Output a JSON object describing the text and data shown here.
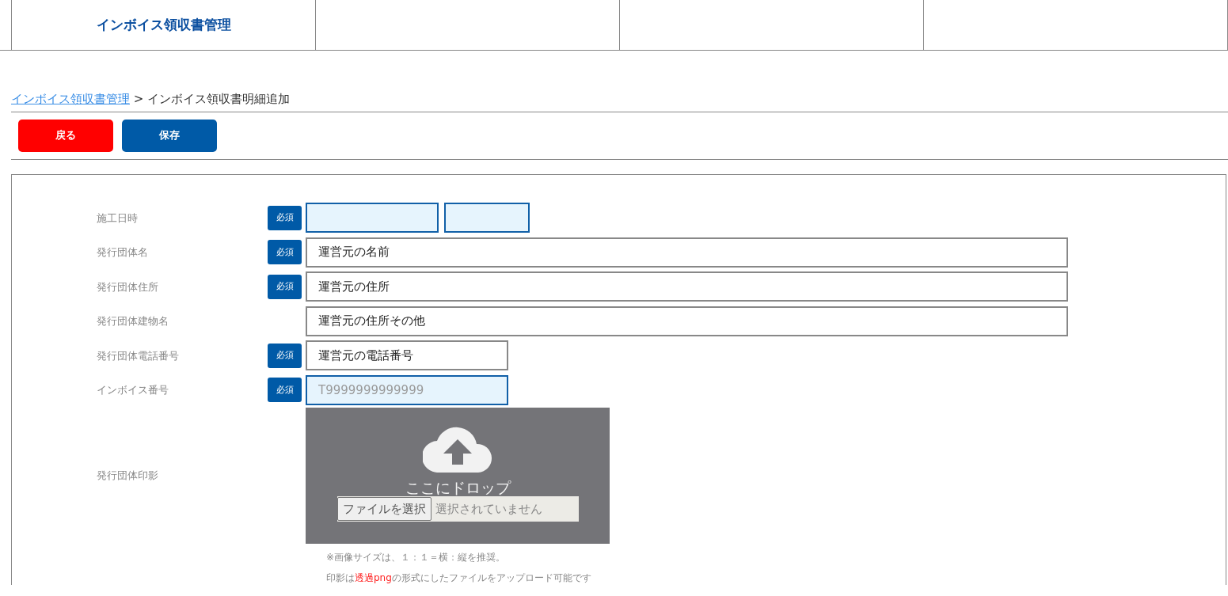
{
  "nav": {
    "items": [
      {
        "label": "インボイス領収書管理"
      }
    ]
  },
  "breadcrumb": {
    "link": "インボイス領収書管理",
    "separator": ">",
    "current": "インボイス領収書明細追加"
  },
  "buttons": [
    {
      "label": "戻る",
      "kind": "back"
    },
    {
      "label": "保存",
      "kind": "save"
    }
  ],
  "form": {
    "fields": [
      {
        "label": "施工日時",
        "required_badge": "必須",
        "kind": "datetime",
        "inputs": [
          {
            "highlighted": true
          },
          {
            "highlighted": true
          }
        ]
      },
      {
        "label": "発行団体名",
        "required_badge": "必須",
        "kind": "text",
        "inputs": [
          {
            "value": "運営元の名前",
            "highlighted": false
          }
        ]
      },
      {
        "label": "発行団体住所",
        "required_badge": "必須",
        "kind": "text",
        "inputs": [
          {
            "value": "運営元の住所",
            "highlighted": false
          }
        ]
      },
      {
        "label": "発行団体建物名",
        "kind": "text",
        "inputs": [
          {
            "value": "運営元の住所その他",
            "highlighted": false
          }
        ]
      },
      {
        "label": "発行団体電話番号",
        "required_badge": "必須",
        "kind": "short_text",
        "inputs": [
          {
            "value": "運営元の電話番号",
            "highlighted": false
          }
        ]
      },
      {
        "label": "インボイス番号",
        "required_badge": "必須",
        "kind": "short_text",
        "inputs": [
          {
            "placeholder": "T9999999999999",
            "highlighted": true
          }
        ]
      },
      {
        "label": "発行団体印影",
        "kind": "file",
        "dropzone": {
          "text": "ここにドロップ",
          "button": "ファイルを選択",
          "status": "選択されていません"
        },
        "notes": [
          [
            {
              "text": "※画像サイズは、１：１＝横：縦を推奨。",
              "highlight": false
            }
          ],
          [
            {
              "text": "印影は",
              "highlight": false
            },
            {
              "text": "透過png",
              "highlight": true
            },
            {
              "text": "の形式にしたファイルをアップロード可能です",
              "highlight": false
            }
          ]
        ]
      }
    ]
  }
}
